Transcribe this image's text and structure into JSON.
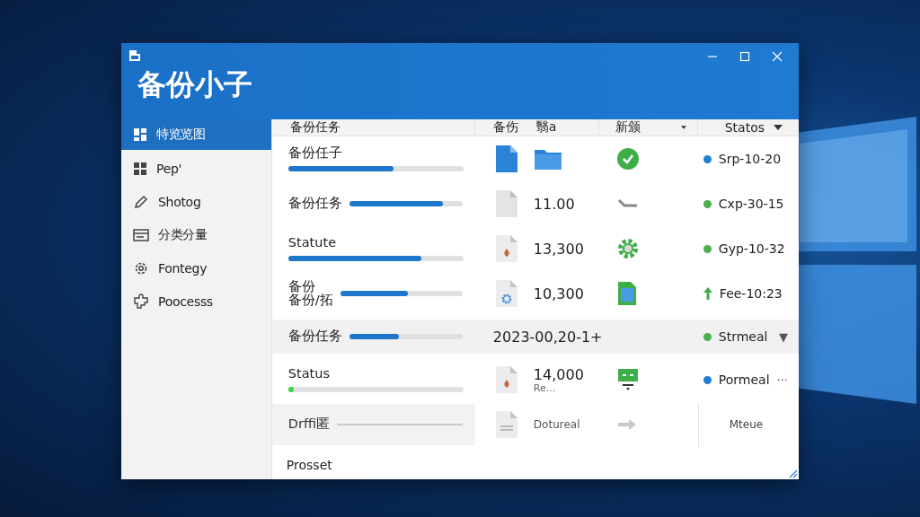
{
  "window": {
    "title": "备份小子"
  },
  "sidebar": {
    "items": [
      {
        "label": "特览览图",
        "selected": true
      },
      {
        "label": "Pep'",
        "selected": false
      },
      {
        "label": "Shotog",
        "selected": false
      },
      {
        "label": "分类分量",
        "selected": false
      },
      {
        "label": "Fontegy",
        "selected": false
      },
      {
        "label": "Poocesss",
        "selected": false
      }
    ]
  },
  "table": {
    "columns": [
      {
        "label": "备份任务",
        "sortable": false
      },
      {
        "label": "备伤",
        "sortable": false
      },
      {
        "label": "翳a",
        "sortable": false
      },
      {
        "label": "新颁",
        "sortable": true
      },
      {
        "label": "Statos",
        "sortable": true
      }
    ],
    "rows": [
      {
        "name": "备份任子",
        "kind": "stacked",
        "level": 0.6,
        "selected": false,
        "disabled": false,
        "status": {
          "kind": "dot",
          "color": "#1f7fd6",
          "text": "Srp-10-20"
        }
      },
      {
        "name": "备份任务",
        "kind": "inline",
        "level": 0.83,
        "selected": false,
        "disabled": false,
        "value": "11.00",
        "status": {
          "kind": "dot",
          "color": "#4caf50",
          "text": "Cxp-30-15"
        }
      },
      {
        "name": "Statute",
        "kind": "stacked",
        "level": 0.76,
        "selected": false,
        "disabled": false,
        "value": "13,300",
        "status": {
          "kind": "dot",
          "color": "#4caf50",
          "text": "Gyp-10-32"
        }
      },
      {
        "name": "备份",
        "name_2": "备份/拓",
        "kind": "inline",
        "level": 0.55,
        "selected": false,
        "disabled": false,
        "value": "10,300",
        "status": {
          "kind": "arrow",
          "color": "#3fae49",
          "text": "Fee-10:23"
        }
      },
      {
        "name": "备份任务",
        "kind": "summary",
        "level": 0.44,
        "selected": true,
        "disabled": false,
        "value": "2023-00,20-1+",
        "status": {
          "kind": "dot",
          "color": "#4caf50",
          "text": "Strmeal",
          "action": "▼"
        }
      },
      {
        "name": "Status",
        "kind": "stacked",
        "level": 0.02,
        "selected": false,
        "disabled": false,
        "value": "14,000",
        "note": "Re...",
        "status": {
          "kind": "dot",
          "color": "#1f7fd6",
          "text": "Pormeal",
          "action": "···"
        }
      },
      {
        "name": "Drffi匿",
        "kind": "inline",
        "level": 0,
        "selected": false,
        "disabled": true,
        "value": "Dotureal",
        "status": {
          "kind": "none",
          "text": "Mteue"
        }
      }
    ]
  },
  "footer": {
    "text": "Prosset"
  }
}
